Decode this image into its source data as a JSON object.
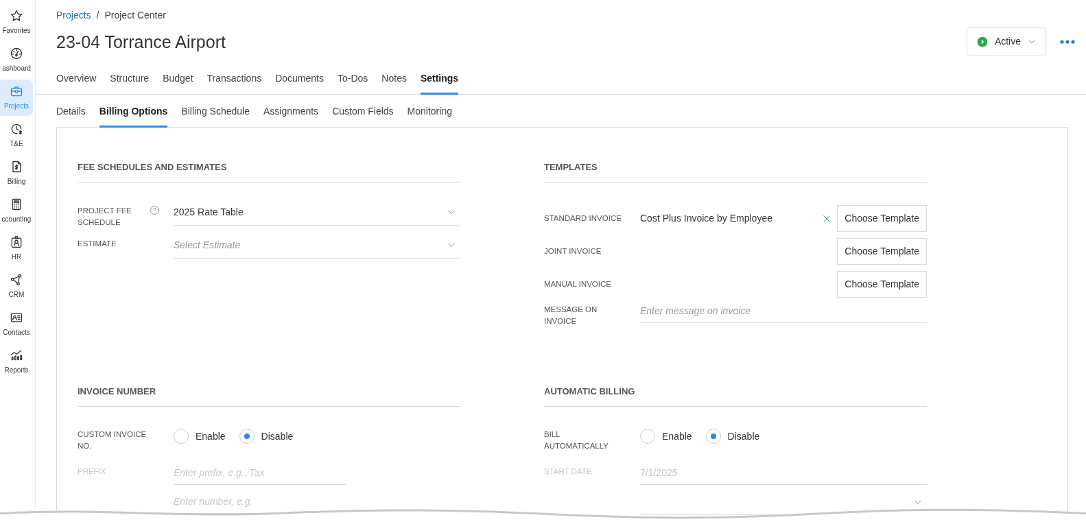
{
  "sidebar": {
    "items": [
      {
        "label": "Favorites",
        "selected": false
      },
      {
        "label": "ashboard",
        "selected": false
      },
      {
        "label": "Projects",
        "selected": true
      },
      {
        "label": "T&E",
        "selected": false
      },
      {
        "label": "Billing",
        "selected": false
      },
      {
        "label": "ccounting",
        "selected": false
      },
      {
        "label": "HR",
        "selected": false
      },
      {
        "label": "CRM",
        "selected": false
      },
      {
        "label": "Contacts",
        "selected": false
      },
      {
        "label": "Reports",
        "selected": false
      }
    ]
  },
  "breadcrumb": [
    {
      "label": "Projects",
      "link": true
    },
    {
      "label": "Project Center",
      "link": false
    }
  ],
  "breadcrumb_separator": "/",
  "title": "23-04 Torrance Airport",
  "status": {
    "label": "Active"
  },
  "tabs": [
    {
      "label": "Overview",
      "selected": false
    },
    {
      "label": "Structure",
      "selected": false
    },
    {
      "label": "Budget",
      "selected": false
    },
    {
      "label": "Transactions",
      "selected": false
    },
    {
      "label": "Documents",
      "selected": false
    },
    {
      "label": "To-Dos",
      "selected": false
    },
    {
      "label": "Notes",
      "selected": false
    },
    {
      "label": "Settings",
      "selected": true
    }
  ],
  "subtabs": [
    {
      "label": "Details",
      "selected": false
    },
    {
      "label": "Billing Options",
      "selected": true
    },
    {
      "label": "Billing Schedule",
      "selected": false
    },
    {
      "label": "Assignments",
      "selected": false
    },
    {
      "label": "Custom Fields",
      "selected": false
    },
    {
      "label": "Monitoring",
      "selected": false
    }
  ],
  "sections": [
    {
      "title": "FEE SCHEDULES AND ESTIMATES",
      "fields": [
        {
          "kind": "select",
          "label": "PROJECT FEE SCHEDULE",
          "help": true,
          "value": "2025 Rate Table"
        },
        {
          "kind": "select",
          "label": "ESTIMATE",
          "placeholder": "Select Estimate"
        }
      ]
    },
    {
      "title": "TEMPLATES",
      "fields": [
        {
          "kind": "template",
          "label": "STANDARD INVOICE",
          "value": "Cost Plus Invoice by Employee",
          "button": "Choose Template"
        },
        {
          "kind": "template",
          "label": "JOINT INVOICE",
          "button": "Choose Template"
        },
        {
          "kind": "template",
          "label": "MANUAL INVOICE",
          "button": "Choose Template"
        },
        {
          "kind": "text",
          "label": "MESSAGE ON INVOICE",
          "placeholder": "Enter message on invoice"
        }
      ]
    },
    {
      "title": "INVOICE NUMBER",
      "fields": [
        {
          "kind": "radio",
          "label": "CUSTOM INVOICE NO.",
          "options": [
            {
              "label": "Enable",
              "selected": false
            },
            {
              "label": "Disable",
              "selected": true
            }
          ]
        },
        {
          "kind": "text",
          "label": "PREFIX",
          "placeholder": "Enter prefix, e.g., Tax",
          "disabled": true,
          "short": true
        },
        {
          "kind": "text",
          "placeholder": "Enter number, e.g.",
          "disabled": true,
          "short": true
        }
      ]
    },
    {
      "title": "AUTOMATIC BILLING",
      "fields": [
        {
          "kind": "radio",
          "label": "BILL AUTOMATICALLY",
          "options": [
            {
              "label": "Enable",
              "selected": false
            },
            {
              "label": "Disable",
              "selected": true
            }
          ]
        },
        {
          "kind": "text",
          "label": "START DATE",
          "value": "7/1/2025",
          "disabled": true
        },
        {
          "kind": "select"
        }
      ]
    }
  ]
}
